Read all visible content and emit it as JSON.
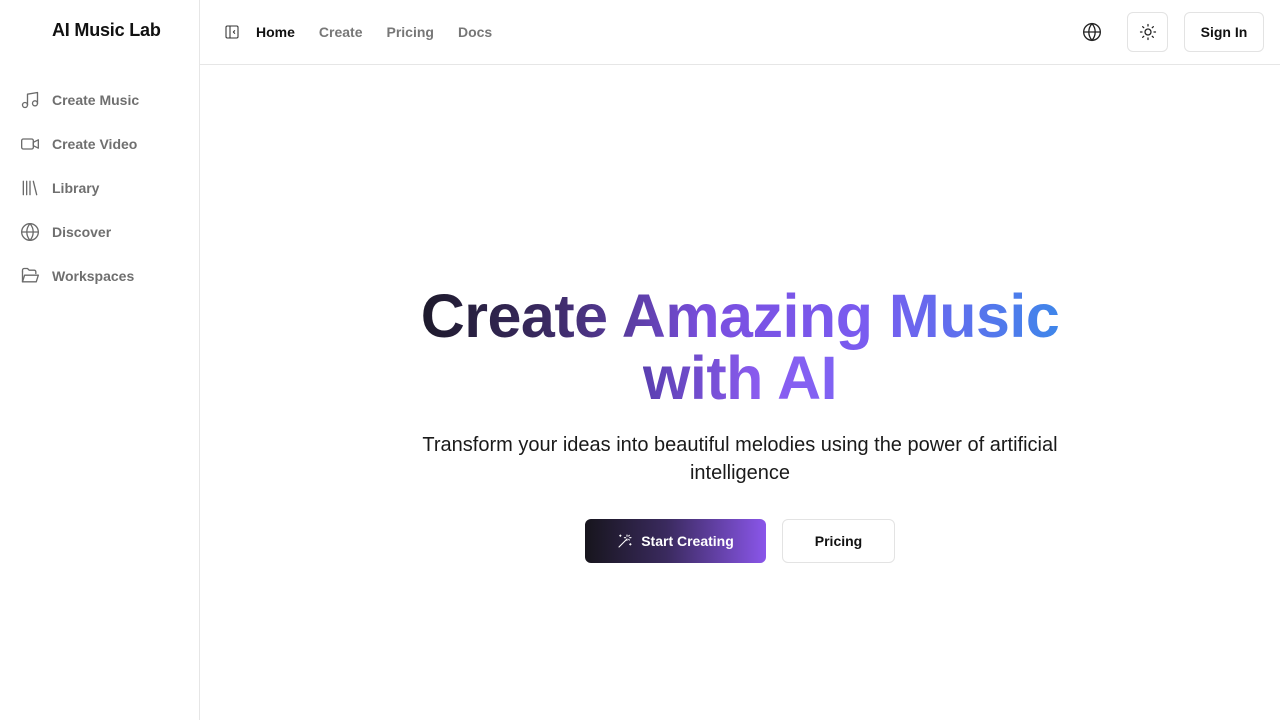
{
  "app": {
    "brand": "AI Music Lab"
  },
  "sidebar": {
    "items": [
      {
        "label": "Create Music",
        "icon": "music-note-icon"
      },
      {
        "label": "Create Video",
        "icon": "video-camera-icon"
      },
      {
        "label": "Library",
        "icon": "library-icon"
      },
      {
        "label": "Discover",
        "icon": "globe-icon"
      },
      {
        "label": "Workspaces",
        "icon": "folder-open-icon"
      }
    ]
  },
  "header": {
    "nav": [
      {
        "label": "Home",
        "active": true
      },
      {
        "label": "Create",
        "active": false
      },
      {
        "label": "Pricing",
        "active": false
      },
      {
        "label": "Docs",
        "active": false
      }
    ],
    "sign_in_label": "Sign In",
    "icons": [
      "sidebar-toggle-icon",
      "globe-icon",
      "sun-icon"
    ]
  },
  "hero": {
    "title_part1": "Create Amazing Music",
    "title_part2": "with AI",
    "subtitle": "Transform your ideas into beautiful melodies using the power of artificial intelligence",
    "primary_cta": "Start Creating",
    "secondary_cta": "Pricing"
  },
  "colors": {
    "accent_purple": "#8b5cf6",
    "accent_blue": "#3b82f6",
    "dark": "#17151d",
    "muted_text": "#6f6f6f",
    "border": "#e6e6e6"
  }
}
